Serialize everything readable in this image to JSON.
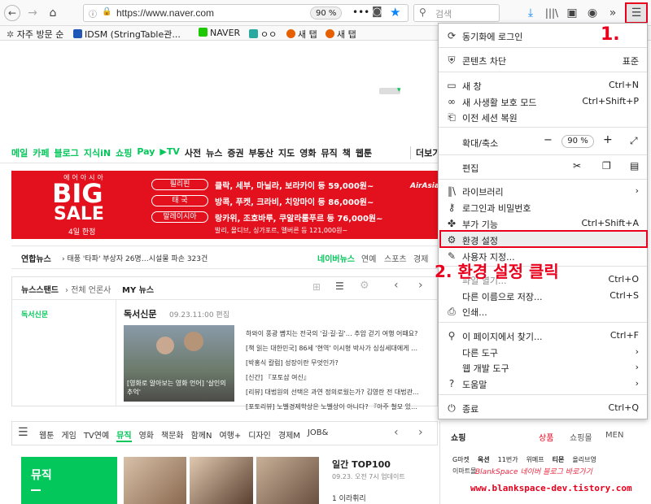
{
  "toolbar": {
    "url": "https://www.naver.com",
    "zoom": "90 %",
    "search_placeholder": "검색"
  },
  "bookmarks": [
    {
      "label": "자주 방문 순",
      "icon": "gear-icon",
      "color": "#666"
    },
    {
      "label": "IDSM (StringTable관...",
      "icon": "idsm-icon",
      "color": "#1e57b5"
    },
    {
      "label": "NAVER",
      "icon": "naver-icon",
      "color": "#1ec800"
    },
    {
      "label": "ㅇㅇ",
      "icon": "tile-icon",
      "color": "#2aa9a0"
    },
    {
      "label": "새 탭",
      "icon": "firefox-icon",
      "color": "#e66000"
    },
    {
      "label": "새 탭",
      "icon": "firefox-icon",
      "color": "#e66000"
    }
  ],
  "page": {
    "nav": [
      "메일",
      "카페",
      "블로그",
      "지식iN",
      "쇼핑",
      "Pay",
      "▶TV",
      "사전",
      "뉴스",
      "증권",
      "부동산",
      "지도",
      "영화",
      "뮤직",
      "책",
      "웹툰",
      "더보기"
    ],
    "banner": {
      "big": "BIG",
      "sale": "SALE",
      "sub": "에어아시아",
      "date": "4일 한정",
      "brand": "AirAsia",
      "rows": [
        {
          "tag": "필리핀",
          "text": "클락, 세부, 마닐라, 보라카이 등 59,000원~"
        },
        {
          "tag": "태 국",
          "text": "방콕, 푸켓, 크라비, 치앙마이 등 86,000원~"
        },
        {
          "tag": "말레이시아",
          "text": "랑카위, 조호바루, 쿠알라룸푸르 등 76,000원~"
        }
      ],
      "foot": "발리, 몰디브, 싱가포르, 멜버른 등 121,000원~"
    },
    "news": {
      "source": "연합뉴스",
      "headline": "태풍 '타파' 부상자 26명…시설물 파손 323건",
      "tabs": [
        "네이버뉴스",
        "연예",
        "스포츠",
        "경제"
      ]
    },
    "stand": {
      "label": "뉴스스탠드",
      "sub": "전체 언론사",
      "my": "MY 뉴스",
      "paper": "독서신문",
      "paper2": "독서신문",
      "time": "09.23.11:00 편집",
      "caption": "[영화로 알아보는 영화 언어] '살인의 추억'",
      "items": [
        "하와이 풍광 뺨치는 전국의 '길·길·길'… 추암 걷기 여행 어때요?",
        "[책 읽는 대한민국] 86세 '현역' 이시형 박사가 싱싱세대에게 …",
        "[박홍식 칼럼] 성장이란 무엇인가?",
        "[신간] 『포토샵 여신』",
        "[리뷰] 대법원의 선택은 과연 정의로웠는가? 김영란 전 대법관…",
        "[포토리뷰] 노벨경제학상은 노벨상이 아니다? 『아주 철모 있…"
      ]
    },
    "cats": [
      "웹툰",
      "게임",
      "TV연예",
      "뮤직",
      "영화",
      "책문화",
      "함께N",
      "여행+",
      "디자인",
      "경제M",
      "JOB&"
    ],
    "music": {
      "label": "뮤직",
      "top": "일간 TOP100",
      "date": "09.23. 오전 7시 업데이트",
      "first": "1 이라휘리"
    },
    "shop": {
      "label": "쇼핑",
      "tabs": [
        "상품",
        "쇼핑몰",
        "MEN"
      ],
      "row1": [
        "G마켓",
        "옥션",
        "11번가",
        "위메프",
        "티몬",
        "올리브영"
      ],
      "row2": [
        "이마트몰",
        "Bla...",
        "...",
        "..."
      ]
    }
  },
  "menu": {
    "items": [
      {
        "icon": "sync-icon",
        "label": "동기화에 로그인",
        "shortcut": ""
      },
      {
        "icon": "shield-icon",
        "label": "콘텐츠 차단",
        "shortcut": "표준"
      },
      {
        "icon": "window-icon",
        "label": "새 창",
        "shortcut": "Ctrl+N"
      },
      {
        "icon": "mask-icon",
        "label": "새 사생활 보호 모드",
        "shortcut": "Ctrl+Shift+P"
      },
      {
        "icon": "restore-icon",
        "label": "이전 세션 복원",
        "shortcut": ""
      },
      {
        "icon": "",
        "label": "확대/축소",
        "shortcut": ""
      },
      {
        "icon": "",
        "label": "편집",
        "shortcut": ""
      },
      {
        "icon": "library-icon",
        "label": "라이브러리",
        "shortcut": "›"
      },
      {
        "icon": "key-icon",
        "label": "로그인과 비밀번호",
        "shortcut": ""
      },
      {
        "icon": "puzzle-icon",
        "label": "부가 기능",
        "shortcut": "Ctrl+Shift+A"
      },
      {
        "icon": "gear-icon",
        "label": "환경 설정",
        "shortcut": ""
      },
      {
        "icon": "brush-icon",
        "label": "사용자 지정...",
        "shortcut": ""
      },
      {
        "icon": "",
        "label": "파일 열기...",
        "shortcut": "Ctrl+O"
      },
      {
        "icon": "",
        "label": "다른 이름으로 저장...",
        "shortcut": "Ctrl+S"
      },
      {
        "icon": "print-icon",
        "label": "인쇄...",
        "shortcut": ""
      },
      {
        "icon": "search-icon",
        "label": "이 페이지에서 찾기...",
        "shortcut": "Ctrl+F"
      },
      {
        "icon": "",
        "label": "다른 도구",
        "shortcut": "›"
      },
      {
        "icon": "",
        "label": "웹 개발 도구",
        "shortcut": "›"
      },
      {
        "icon": "help-icon",
        "label": "도움말",
        "shortcut": "›"
      },
      {
        "icon": "power-icon",
        "label": "종료",
        "shortcut": "Ctrl+Q"
      }
    ],
    "zoom_value": "90 %"
  },
  "annotations": {
    "step1": "1.",
    "step2": "2. 환경 설정 클릭",
    "watermark": "www.blankspace-dev.tistory.com",
    "overlap": "BlankSpace 네이버 블로그 바로가기"
  },
  "colors": {
    "naver_green": "#03c75a",
    "highlight_red": "#e8001c",
    "banner_red": "#e3111d"
  }
}
